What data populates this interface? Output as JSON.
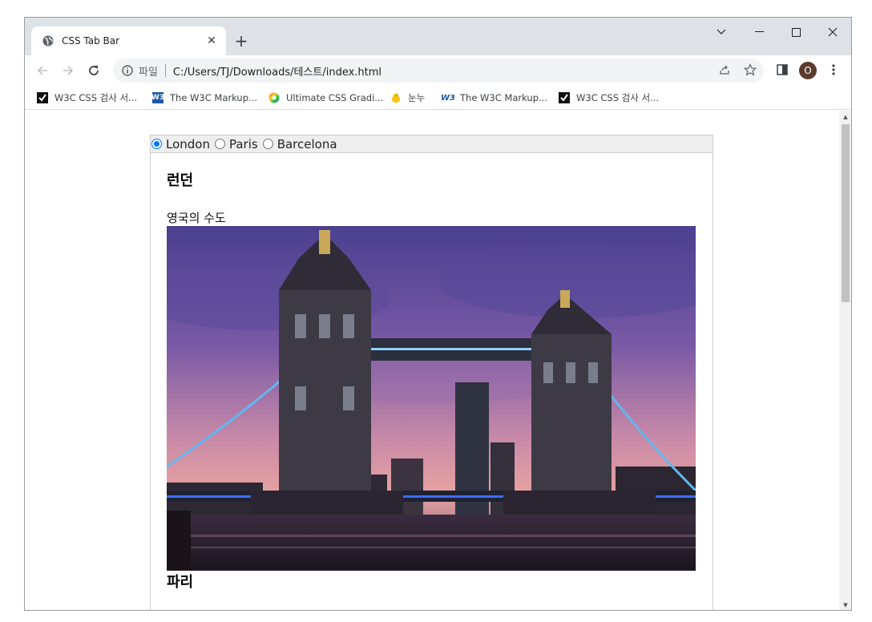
{
  "browser": {
    "tab_title": "CSS Tab Bar",
    "new_tab_label": "+",
    "url_scheme_label": "파일",
    "url": "C:/Users/TJ/Downloads/테스트/index.html",
    "profile_initial": "O",
    "bookmarks": [
      {
        "label": "W3C CSS 검사 서...",
        "icon": "validator-icon"
      },
      {
        "label": "The W3C Markup...",
        "icon": "w3-icon"
      },
      {
        "label": "Ultimate CSS Gradi...",
        "icon": "gradient-icon"
      },
      {
        "label": "눈누",
        "icon": "chick-icon"
      },
      {
        "label": "The W3C Markup...",
        "icon": "w3c-logo-icon"
      },
      {
        "label": "W3C CSS 검사 서...",
        "icon": "validator-icon"
      }
    ]
  },
  "page": {
    "tabs": [
      {
        "label": "London",
        "checked": true
      },
      {
        "label": "Paris",
        "checked": false
      },
      {
        "label": "Barcelona",
        "checked": false
      }
    ],
    "sections": [
      {
        "heading": "런던",
        "text": "영국의 수도",
        "image": "tower-bridge-photo"
      },
      {
        "heading": "파리"
      }
    ]
  },
  "colors": {
    "radio_accent": "#0075ff",
    "tab_bar_bg": "#eeeeee",
    "chrome_frame": "#dee1e6"
  }
}
